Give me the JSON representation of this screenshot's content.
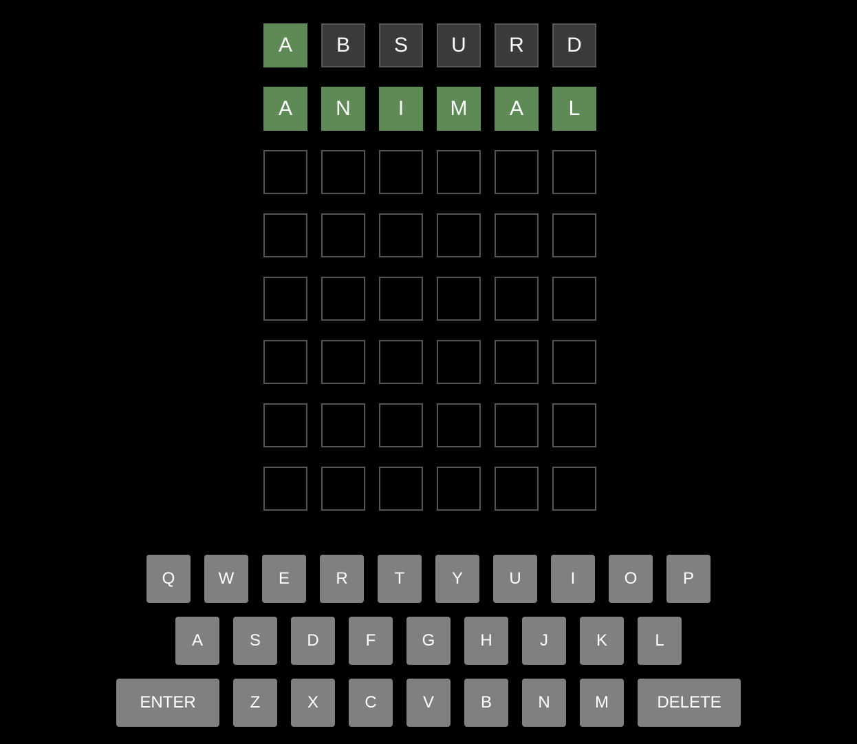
{
  "colors": {
    "background": "#000000",
    "correct": "#5e8b55",
    "absent": "#3a3a3c",
    "empty_border": "#555555",
    "key": "#808080"
  },
  "board": {
    "rows": [
      {
        "letters": [
          "A",
          "B",
          "S",
          "U",
          "R",
          "D"
        ],
        "states": [
          "correct",
          "absent",
          "absent",
          "absent",
          "absent",
          "absent"
        ]
      },
      {
        "letters": [
          "A",
          "N",
          "I",
          "M",
          "A",
          "L"
        ],
        "states": [
          "correct",
          "correct",
          "correct",
          "correct",
          "correct",
          "correct"
        ]
      },
      {
        "letters": [
          "",
          "",
          "",
          "",
          "",
          ""
        ],
        "states": [
          "empty",
          "empty",
          "empty",
          "empty",
          "empty",
          "empty"
        ]
      },
      {
        "letters": [
          "",
          "",
          "",
          "",
          "",
          ""
        ],
        "states": [
          "empty",
          "empty",
          "empty",
          "empty",
          "empty",
          "empty"
        ]
      },
      {
        "letters": [
          "",
          "",
          "",
          "",
          "",
          ""
        ],
        "states": [
          "empty",
          "empty",
          "empty",
          "empty",
          "empty",
          "empty"
        ]
      },
      {
        "letters": [
          "",
          "",
          "",
          "",
          "",
          ""
        ],
        "states": [
          "empty",
          "empty",
          "empty",
          "empty",
          "empty",
          "empty"
        ]
      },
      {
        "letters": [
          "",
          "",
          "",
          "",
          "",
          ""
        ],
        "states": [
          "empty",
          "empty",
          "empty",
          "empty",
          "empty",
          "empty"
        ]
      },
      {
        "letters": [
          "",
          "",
          "",
          "",
          "",
          ""
        ],
        "states": [
          "empty",
          "empty",
          "empty",
          "empty",
          "empty",
          "empty"
        ]
      }
    ]
  },
  "keyboard": {
    "rows": [
      [
        "Q",
        "W",
        "E",
        "R",
        "T",
        "Y",
        "U",
        "I",
        "O",
        "P"
      ],
      [
        "A",
        "S",
        "D",
        "F",
        "G",
        "H",
        "J",
        "K",
        "L"
      ],
      [
        "ENTER",
        "Z",
        "X",
        "C",
        "V",
        "B",
        "N",
        "M",
        "DELETE"
      ]
    ]
  }
}
